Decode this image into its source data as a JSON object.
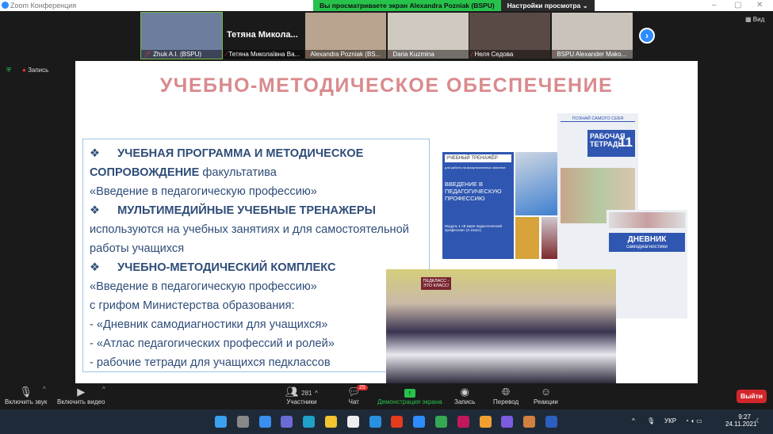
{
  "window": {
    "title": "Zoom Конференция",
    "minimize": "–",
    "restore": "▢",
    "close": "✕"
  },
  "banner": {
    "viewing": "Вы просматриваете экран Alexandra Pozniak (BSPU)",
    "view_settings": "Настройки просмотра ⌄"
  },
  "participants_strip": [
    {
      "name": "Zhuk A.I. (BSPU)",
      "bg": "#6d7d9e"
    },
    {
      "name": "Тетяна Миколаївна Ва...",
      "big_name": "Тетяна Микола...",
      "bg": "#1a1a1a"
    },
    {
      "name": "Alexandra Pozniak (BS...",
      "bg": "#b8a48f"
    },
    {
      "name": "Daria Kuzmina",
      "bg": "#cfc9bf"
    },
    {
      "name": "Неля Седова",
      "bg": "#5a4a46"
    },
    {
      "name": "BSPU Alexander Mako...",
      "bg": "#c9c3bb"
    }
  ],
  "view_button": "Вид",
  "recording": "Запись",
  "slide": {
    "title": "УЧЕБНО-МЕТОДИЧЕСКОЕ ОБЕСПЕЧЕНИЕ",
    "lines": [
      {
        "bullet": "❖",
        "bold": "УЧЕБНАЯ ПРОГРАММА И МЕТОДИЧЕСКОЕ"
      },
      {
        "bold": "СОПРОВОЖДЕНИЕ",
        "text": " факультатива"
      },
      {
        "text": "«Введение в педагогическую профессию»"
      },
      {
        "bullet": "❖",
        "bold": "МУЛЬТИМЕДИЙНЫЕ УЧЕБНЫЕ ТРЕНАЖЕРЫ"
      },
      {
        "text": "используются на учебных занятиях и для самостоятельной"
      },
      {
        "text": "работы учащихся"
      },
      {
        "bullet": "❖",
        "bold": "УЧЕБНО-МЕТОДИЧЕСКИЙ КОМПЛЕКС"
      },
      {
        "text": "«Введение в педагогическую профессию»"
      },
      {
        "text": "с грифом Министерства образования:"
      },
      {
        "text": "- «Дневник самодиагностики для учащихся»"
      },
      {
        "text": "- «Атлас педагогических профессий и ролей»"
      },
      {
        "text": "- рабочие тетради для учащихся педклассов"
      }
    ],
    "book1": {
      "header": "УЧЕБНЫЙ ТРЕНАЖЁР",
      "sub": "для работы на факультативных занятиях",
      "title": "ВВЕДЕНИЕ В ПЕДАГОГИЧЕСКУЮ ПРОФЕССИЮ",
      "module": "Модуль 1 «В мире педагогической профессии» (X класс)"
    },
    "book2": {
      "header": "ПОЗНАЙ САМОГО СЕБЯ",
      "title": "РАБОЧАЯ ТЕТРАДЬ",
      "grade": "11"
    },
    "book3": {
      "title": "ДНЕВНИК",
      "sub": "самодиагностики"
    },
    "photo_sign": "ПЕДКЛАСС - ЭТО КЛАСС!"
  },
  "toolbar": {
    "unmute": "Включить звук",
    "start_video": "Включить видео",
    "participants": "Участники",
    "participants_count": "281",
    "chat": "Чат",
    "chat_badge": "25",
    "share": "Демонстрация экрана",
    "record": "Запись",
    "translate": "Перевод",
    "reactions": "Реакции",
    "leave": "Выйти"
  },
  "taskbar": {
    "lang": "УКР",
    "time": "9:27",
    "date": "24.11.2021",
    "icons": [
      "windows-icon",
      "taskview-icon",
      "widgets-icon",
      "teams-icon",
      "edge-icon",
      "explorer-icon",
      "store-icon",
      "mail-icon",
      "office-icon",
      "zoom-icon",
      "chrome-icon",
      "powerpoint-icon",
      "brave-icon",
      "viber-icon",
      "chrome-profile-icon",
      "word-icon"
    ],
    "icon_colors": [
      "#3aa0f0",
      "#888",
      "#3a8ef0",
      "#6b6bd6",
      "#1fa0c8",
      "#f2c230",
      "#eee",
      "#2a8fe0",
      "#e33b1e",
      "#2d8cff",
      "#34a853",
      "#c2185b",
      "#f0a030",
      "#7b5ce0",
      "#d08040",
      "#2b5fbf"
    ]
  },
  "colors": {
    "accent": "#2d8cff",
    "share_green": "#27c24c",
    "leave_red": "#d3262b",
    "slide_title": "#d98a8d",
    "slide_text": "#2f4d78",
    "book_blue": "#2f56b0"
  }
}
